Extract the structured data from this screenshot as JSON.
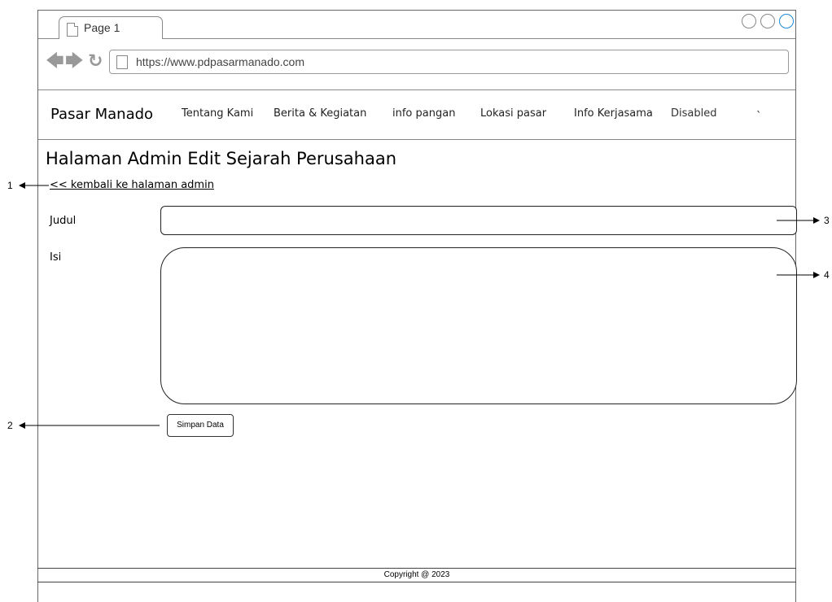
{
  "browser": {
    "tab_label": "Page 1",
    "url": "https://www.pdpasarmanado.com"
  },
  "navbar": {
    "brand": "Pasar Manado",
    "items": [
      {
        "label": "Tentang Kami"
      },
      {
        "label": "Berita & Kegiatan"
      },
      {
        "label": "info pangan"
      },
      {
        "label": "Lokasi pasar"
      },
      {
        "label": "Info Kerjasama"
      },
      {
        "label": "Disabled"
      }
    ],
    "trailing_mark": "`"
  },
  "page": {
    "title": "Halaman Admin Edit Sejarah Perusahaan",
    "back_link": "<< kembali ke halaman admin"
  },
  "form": {
    "judul_label": "Judul",
    "judul_value": "",
    "isi_label": "Isi",
    "isi_value": "",
    "submit_label": "Simpan Data"
  },
  "footer": {
    "copyright": "Copyright @ 2023"
  },
  "annotations": {
    "a1": "1",
    "a2": "2",
    "a3": "3",
    "a4": "4"
  },
  "colors": {
    "window_control_accent": "#1e8ad6",
    "border": "#888888"
  },
  "icons": [
    "page-icon",
    "back-arrow-icon",
    "forward-arrow-icon",
    "reload-icon",
    "window-control-icon"
  ]
}
